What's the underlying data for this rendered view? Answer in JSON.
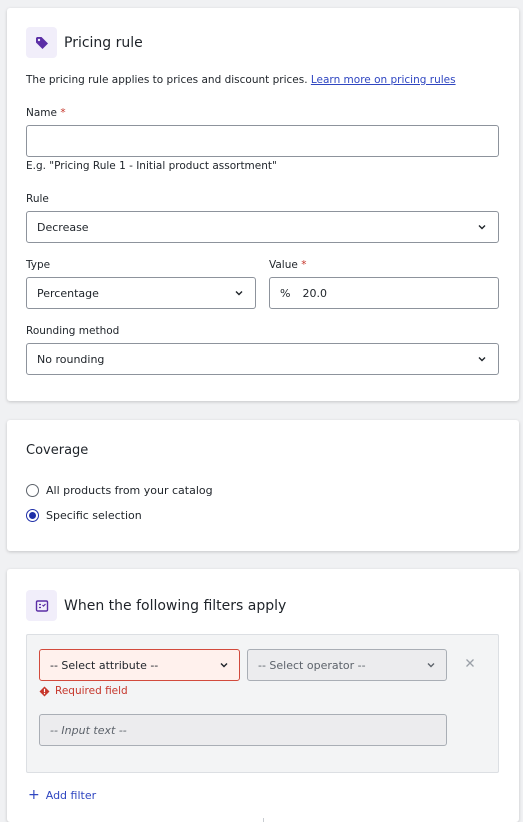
{
  "pricing_rule": {
    "title": "Pricing rule",
    "icon": "tag-icon",
    "description": "The pricing rule applies to prices and discount prices.",
    "learn_more": "Learn more on pricing rules",
    "name": {
      "label": "Name",
      "required_mark": "*",
      "value": "",
      "hint": "E.g. \"Pricing Rule 1 - Initial product assortment\""
    },
    "rule": {
      "label": "Rule",
      "value": "Decrease"
    },
    "type": {
      "label": "Type",
      "value": "Percentage"
    },
    "value": {
      "label": "Value",
      "required_mark": "*",
      "prefix": "%",
      "value": "20.0"
    },
    "rounding": {
      "label": "Rounding method",
      "value": "No rounding"
    }
  },
  "coverage": {
    "title": "Coverage",
    "options": [
      {
        "label": "All products from your catalog",
        "checked": false
      },
      {
        "label": "Specific selection",
        "checked": true
      }
    ]
  },
  "filters": {
    "title": "When the following filters apply",
    "icon": "filter-list-icon",
    "attribute_placeholder": "-- Select attribute --",
    "operator_placeholder": "-- Select operator --",
    "error": "Required field",
    "text_placeholder": "-- Input text --",
    "add_filter": "Add filter",
    "add_icon": "+"
  },
  "colors": {
    "accent": "#2f46c1",
    "error": "#c6362b",
    "icon_bg": "#f1eefa",
    "icon_fg": "#5b2ea6"
  }
}
